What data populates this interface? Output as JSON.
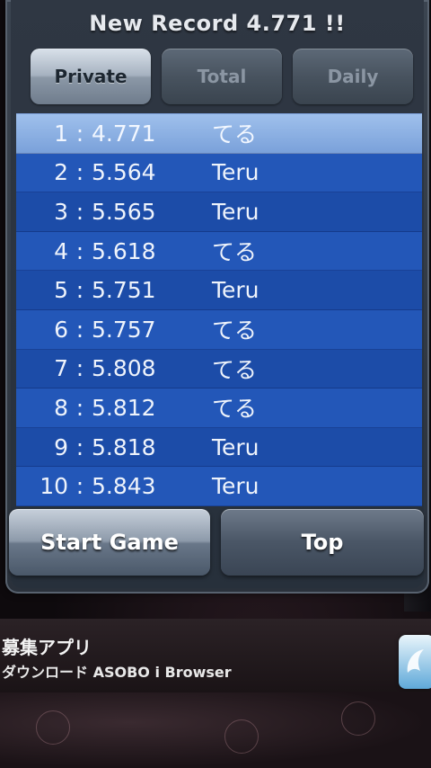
{
  "header": {
    "title": "New Record 4.771 !!"
  },
  "tabs": [
    {
      "label": "Private",
      "active": true
    },
    {
      "label": "Total",
      "active": false
    },
    {
      "label": "Daily",
      "active": false
    }
  ],
  "leaderboard": [
    {
      "rank": "1",
      "score": "4.771",
      "name": "てる"
    },
    {
      "rank": "2",
      "score": "5.564",
      "name": "Teru"
    },
    {
      "rank": "3",
      "score": "5.565",
      "name": "Teru"
    },
    {
      "rank": "4",
      "score": "5.618",
      "name": "てる"
    },
    {
      "rank": "5",
      "score": "5.751",
      "name": "Teru"
    },
    {
      "rank": "6",
      "score": "5.757",
      "name": "てる"
    },
    {
      "rank": "7",
      "score": "5.808",
      "name": "てる"
    },
    {
      "rank": "8",
      "score": "5.812",
      "name": "てる"
    },
    {
      "rank": "9",
      "score": "5.818",
      "name": "Teru"
    },
    {
      "rank": "10",
      "score": "5.843",
      "name": "Teru"
    }
  ],
  "buttons": {
    "start": "Start Game",
    "top": "Top"
  },
  "ad": {
    "title": "募集アプリ",
    "subtitle": "ダウンロード ASOBO i Browser",
    "icon": "app-icon"
  },
  "side_number": "1",
  "colors": {
    "board_blue": "#1f4fa9",
    "highlight": "#8fb3e6",
    "panel": "#2f3743"
  }
}
